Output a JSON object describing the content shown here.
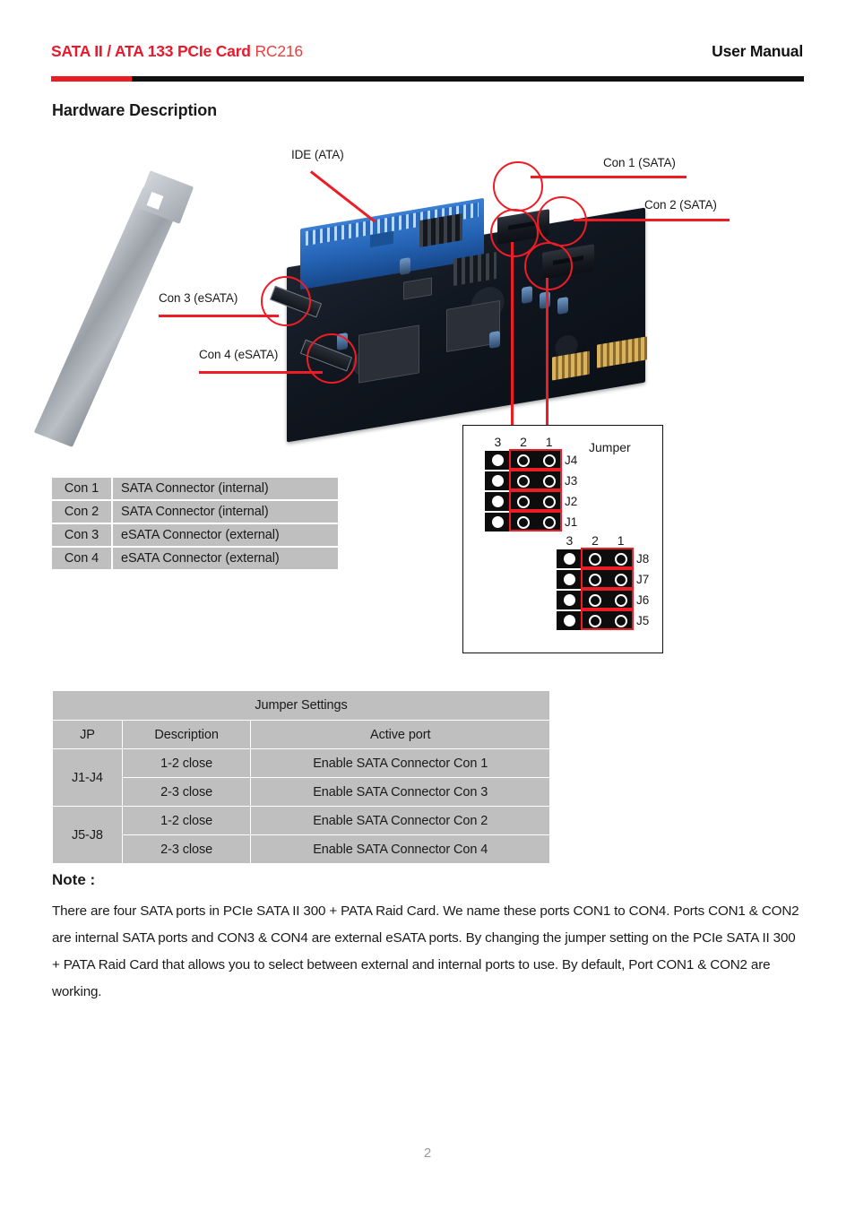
{
  "header": {
    "title_bold": "SATA II / ATA 133 PCIe Card",
    "title_model": "RC216",
    "manual_label": "User Manual",
    "accent_color": "#ec1c24",
    "rule_color": "#111111"
  },
  "section": {
    "heading": "Hardware Description"
  },
  "figure": {
    "annotations": {
      "ide": "IDE (ATA)",
      "con1": "Con 1 (SATA)",
      "con2": "Con 2 (SATA)",
      "con3": "Con 3 (eSATA)",
      "con4": "Con 4 (eSATA)"
    },
    "annotation_color": "#ee1c25"
  },
  "jumper_diagram": {
    "title": "Jumper",
    "pin_headers": [
      "3",
      "2",
      "1"
    ],
    "upper_group": [
      {
        "label": "J4"
      },
      {
        "label": "J3"
      },
      {
        "label": "J2"
      },
      {
        "label": "J1"
      }
    ],
    "lower_group": [
      {
        "label": "J8"
      },
      {
        "label": "J7"
      },
      {
        "label": "J6"
      },
      {
        "label": "J5"
      }
    ],
    "highlight_color": "#ee1c25"
  },
  "connector_table": {
    "rows": [
      {
        "id": "Con 1",
        "desc": "SATA Connector  (internal)"
      },
      {
        "id": "Con 2",
        "desc": "SATA Connector  (internal)"
      },
      {
        "id": "Con 3",
        "desc": "eSATA Connector  (external)"
      },
      {
        "id": "Con 4",
        "desc": "eSATA Connector  (external)"
      }
    ]
  },
  "jumper_settings_table": {
    "title": "Jumper Settings",
    "headers": {
      "jp": "JP",
      "description": "Description",
      "active_port": "Active port"
    },
    "rows": [
      {
        "jp": "J1-J4",
        "description": "1-2 close",
        "active_port": "Enable SATA Connector Con 1"
      },
      {
        "jp": "",
        "description": "2-3 close",
        "active_port": "Enable SATA Connector Con 3"
      },
      {
        "jp": "J5-J8",
        "description": "1-2 close",
        "active_port": "Enable SATA Connector Con 2"
      },
      {
        "jp": "",
        "description": "2-3 close",
        "active_port": "Enable SATA Connector Con 4"
      }
    ]
  },
  "note": {
    "heading": "Note :",
    "body": "There are four SATA ports in PCIe SATA II 300 + PATA Raid Card. We name these ports CON1 to CON4. Ports CON1 & CON2  are internal SATA ports and CON3 & CON4 are external eSATA ports. By changing the jumper setting on the PCIe SATA II 300 + PATA Raid Card that allows you to select between external and internal ports to use. By default, Port CON1 & CON2 are working."
  },
  "footer": {
    "page_number": "2"
  }
}
